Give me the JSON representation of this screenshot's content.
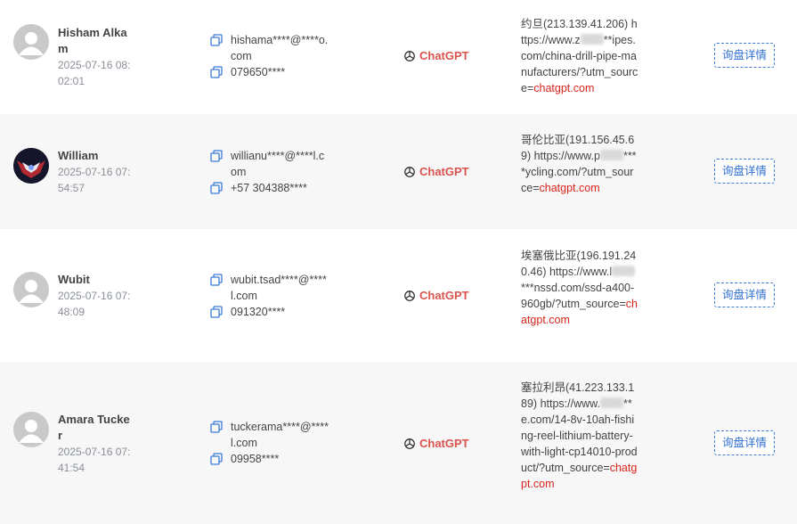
{
  "colors": {
    "accent": "#2f6fcf",
    "source": "#d9534f",
    "utm": "#d9251c",
    "row_alt": "#f7f7f7"
  },
  "rows": [
    {
      "name": "Hisham Alkam",
      "time": "2025-07-16 08:02:01",
      "email": "hishama****@****o.com",
      "phone": "079650****",
      "source": "ChatGPT",
      "location": "约旦(213.139.41.206)",
      "url_prefix": "https://www.z",
      "url_rest": "**ipes.com/china-drill-pipe-manufacturers/?utm_source=",
      "url_utm": "chatgpt.com",
      "button": "询盘详情",
      "avatar": "default"
    },
    {
      "name": "William",
      "time": "2025-07-16 07:54:57",
      "email": "willianu****@****l.com",
      "phone": "+57 304388****",
      "source": "ChatGPT",
      "location": "哥伦比亚(191.156.45.69)",
      "url_prefix": "https://www.p",
      "url_rest": "****ycling.com/?utm_source=",
      "url_utm": "chatgpt.com",
      "button": "询盘详情",
      "avatar": "custom"
    },
    {
      "name": "Wubit",
      "time": "2025-07-16 07:48:09",
      "email": "wubit.tsad****@****l.com",
      "phone": "091320****",
      "source": "ChatGPT",
      "location": "埃塞俄比亚(196.191.240.46)",
      "url_prefix": "https://www.l",
      "url_rest": "***nssd.com/ssd-a400-960gb/?utm_source=",
      "url_utm": "chatgpt.com",
      "button": "询盘详情",
      "avatar": "default"
    },
    {
      "name": "Amara Tucker",
      "time": "2025-07-16 07:41:54",
      "email": "tuckerama****@****l.com",
      "phone": "09958****",
      "source": "ChatGPT",
      "location": "塞拉利昂(41.223.133.189)",
      "url_prefix": "https://www.",
      "url_rest": "**e.com/14-8v-10ah-fishing-reel-lithium-battery-with-light-cp14010-product/?utm_source=",
      "url_utm": "chatgpt.com",
      "button": "询盘详情",
      "avatar": "default"
    }
  ]
}
